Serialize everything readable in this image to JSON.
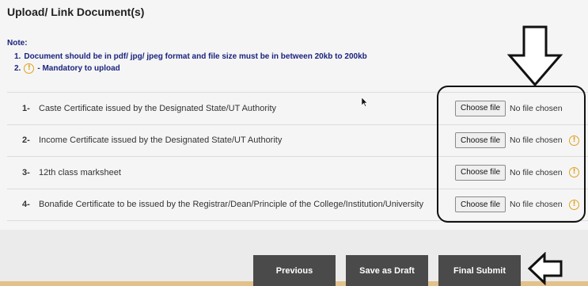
{
  "page": {
    "title": "Upload/ Link Document(s)"
  },
  "note": {
    "heading": "Note:",
    "line1_num": "1.",
    "line1_text": "Document should be in pdf/ jpg/ jpeg format and file size must be in between 20kb to 200kb",
    "line2_num": "2.",
    "line2_icon": "!",
    "line2_text": "- Mandatory to upload"
  },
  "documents": [
    {
      "num": "1-",
      "label": "Caste Certificate issued by the Designated State/UT Authority",
      "button": "Choose file",
      "status": "No file chosen",
      "mandatory": false
    },
    {
      "num": "2-",
      "label": "Income Certificate issued by the Designated State/UT Authority",
      "button": "Choose file",
      "status": "No file chosen",
      "mandatory": true,
      "icon": "!"
    },
    {
      "num": "3-",
      "label": "12th class marksheet",
      "button": "Choose file",
      "status": "No file chosen",
      "mandatory": true,
      "icon": "!"
    },
    {
      "num": "4-",
      "label": "Bonafide Certificate to be issued by the Registrar/Dean/Principle of the College/Institution/University",
      "button": "Choose file",
      "status": "No file chosen",
      "mandatory": true,
      "icon": "!"
    }
  ],
  "footer": {
    "previous": "Previous",
    "save_draft": "Save as Draft",
    "final_submit": "Final Submit"
  },
  "colors": {
    "note_text": "#1a237e",
    "warning": "#e0a21c",
    "footer_button": "#4a4a4a"
  },
  "icons": [
    "warning-circle-icon",
    "down-arrow-icon",
    "left-arrow-icon",
    "mouse-cursor-icon"
  ]
}
